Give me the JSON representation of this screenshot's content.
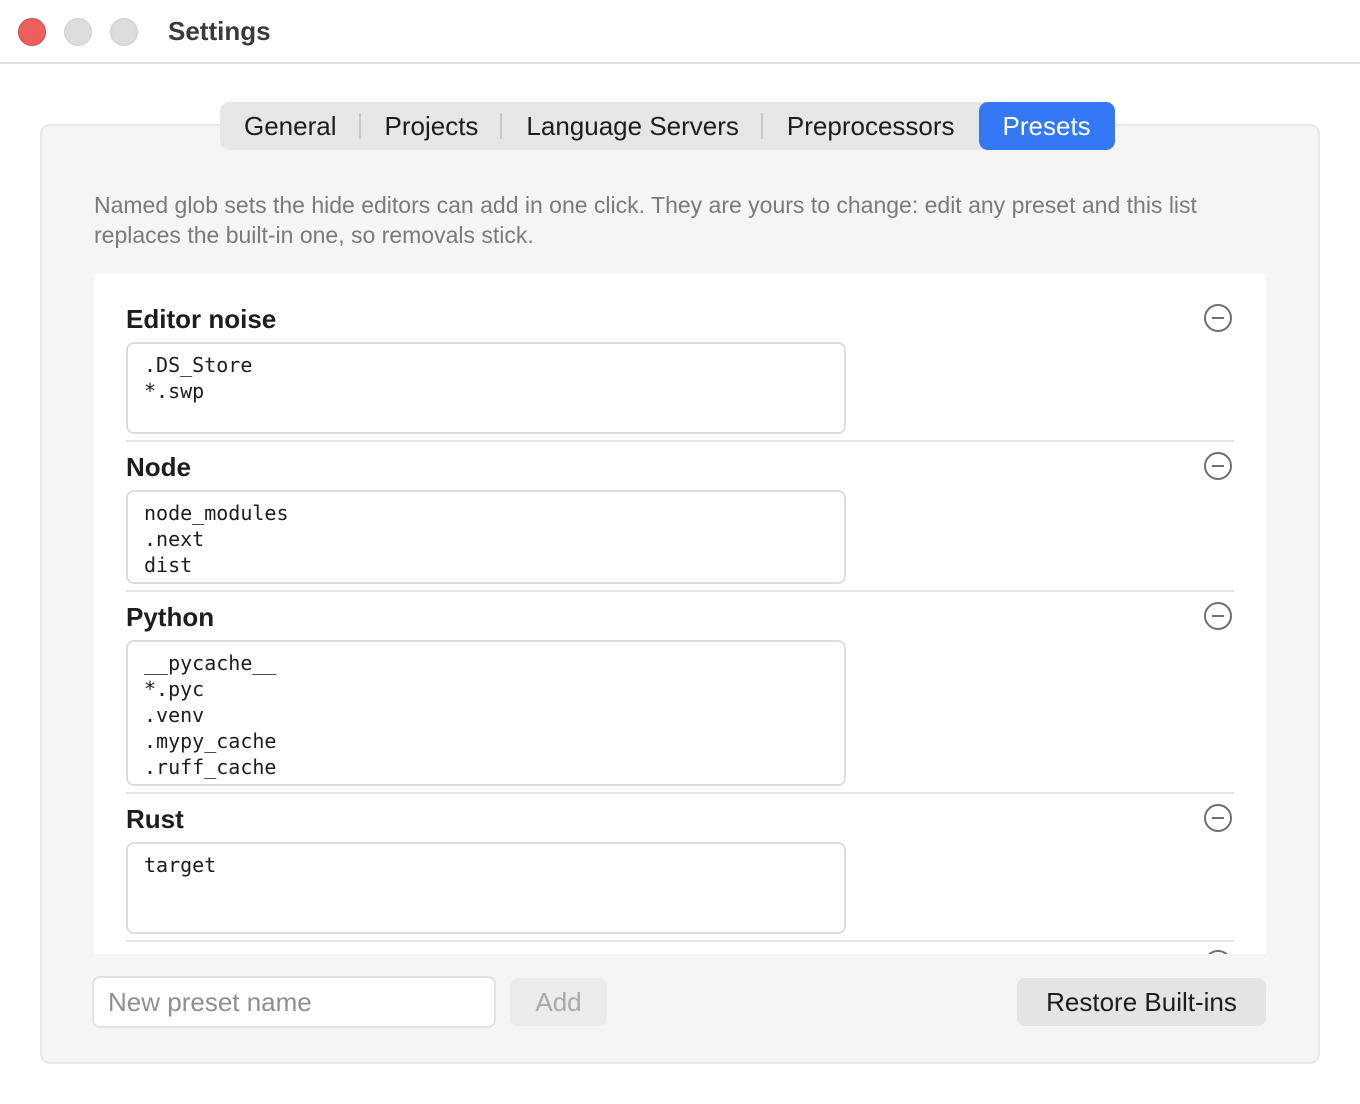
{
  "window": {
    "title": "Settings"
  },
  "tabs": [
    {
      "label": "General",
      "active": false
    },
    {
      "label": "Projects",
      "active": false
    },
    {
      "label": "Language Servers",
      "active": false
    },
    {
      "label": "Preprocessors",
      "active": false
    },
    {
      "label": "Presets",
      "active": true
    }
  ],
  "description": "Named glob sets the hide editors can add in one click. They are yours to change: edit any preset and this list replaces the built-in one, so removals stick.",
  "presets": [
    {
      "name": "Editor noise",
      "globs": ".DS_Store\n*.swp"
    },
    {
      "name": "Node",
      "globs": "node_modules\n.next\ndist"
    },
    {
      "name": "Python",
      "globs": "__pycache__\n*.pyc\n.venv\n.mypy_cache\n.ruff_cache"
    },
    {
      "name": "Rust",
      "globs": "target"
    }
  ],
  "footer": {
    "new_preset_placeholder": "New preset name",
    "add_label": "Add",
    "restore_label": "Restore Built-ins"
  },
  "colors": {
    "accent": "#3478f6",
    "close": "#ec5f5c"
  }
}
